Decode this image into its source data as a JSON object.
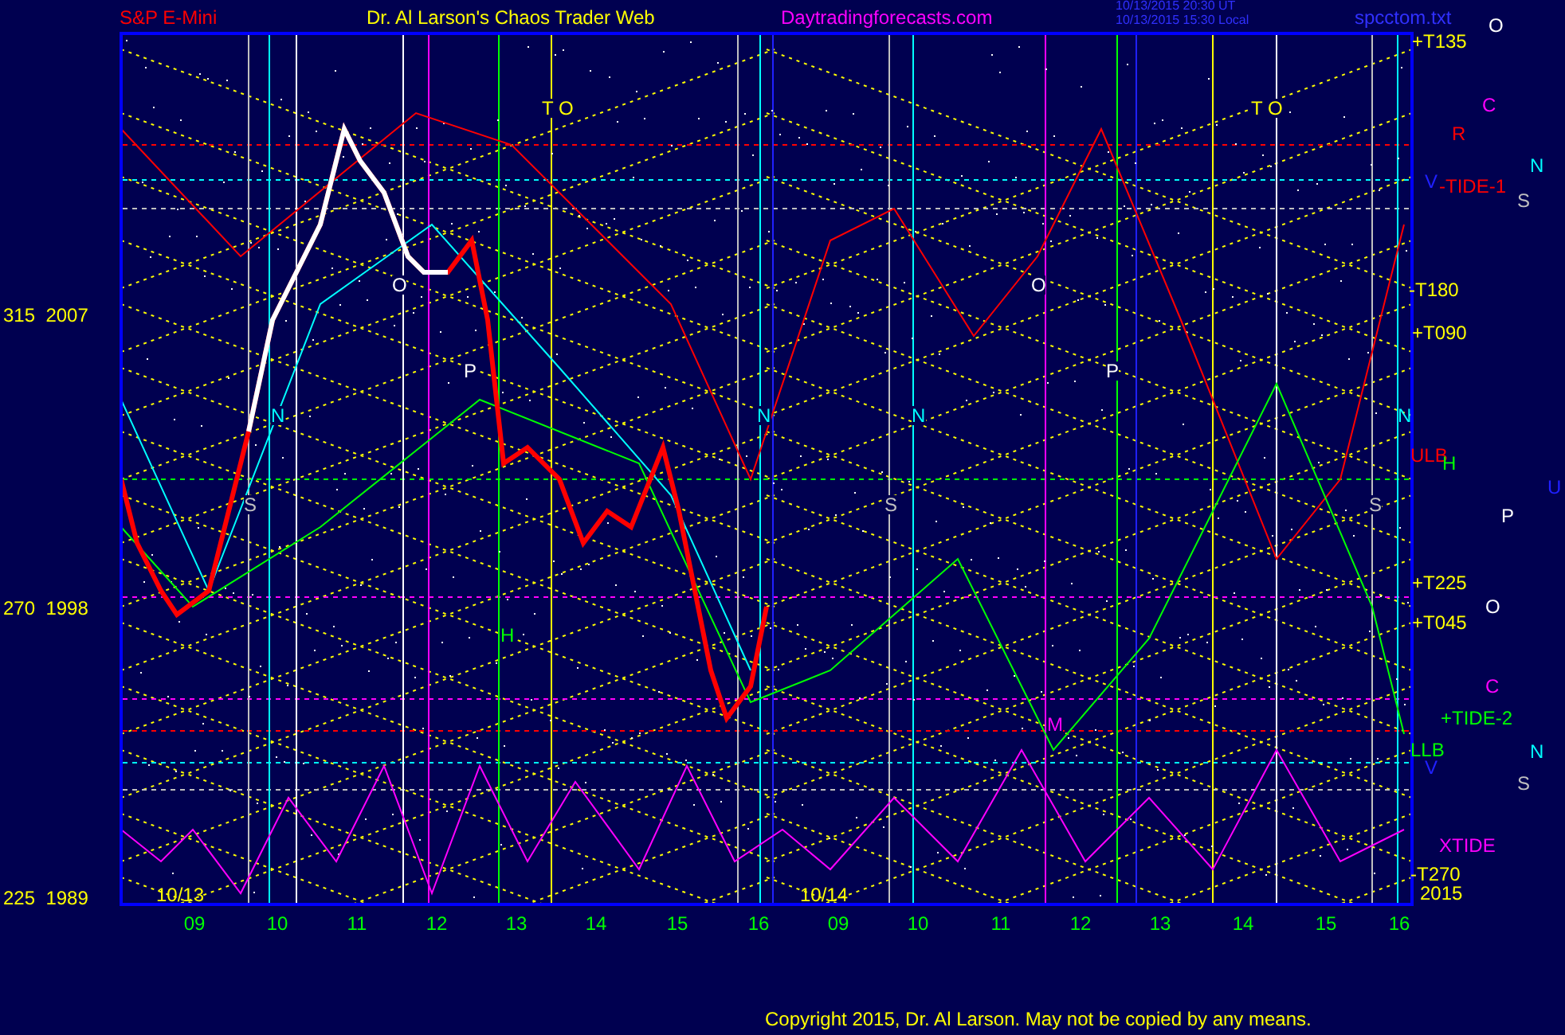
{
  "header": {
    "symbol": "S&P E-Mini",
    "title": "Dr. Al Larson's Chaos Trader Web",
    "site": "Daytradingforecasts.com",
    "time_ut": "10/13/2015 20:30 UT",
    "time_local": "10/13/2015 15:30 Local",
    "file": "spcctom.txt",
    "marker": "O"
  },
  "price_axis": [
    {
      "degree": "315",
      "price": "2007"
    },
    {
      "degree": "270",
      "price": "1998"
    },
    {
      "degree": "225",
      "price": "1989"
    }
  ],
  "days": [
    "10/13",
    "10/14"
  ],
  "hours": [
    "09",
    "10",
    "11",
    "12",
    "13",
    "14",
    "15",
    "16",
    "09",
    "10",
    "11",
    "12",
    "13",
    "14",
    "15",
    "16"
  ],
  "plot_labels": [
    {
      "text": "T O",
      "color": "#ffff00"
    },
    {
      "text": "T O",
      "color": "#ffff00"
    },
    {
      "text": "N",
      "color": "#00ffff"
    },
    {
      "text": "S",
      "color": "#c0c0c0"
    },
    {
      "text": "O",
      "color": "#ffffff"
    },
    {
      "text": "P",
      "color": "#ffffff"
    },
    {
      "text": "H",
      "color": "#00ff00"
    },
    {
      "text": "N",
      "color": "#00ffff"
    },
    {
      "text": "N",
      "color": "#00ffff"
    },
    {
      "text": "S",
      "color": "#c0c0c0"
    },
    {
      "text": "O",
      "color": "#ffffff"
    },
    {
      "text": "P",
      "color": "#ffffff"
    },
    {
      "text": "S",
      "color": "#c0c0c0"
    },
    {
      "text": "M",
      "color": "#ff00ff"
    }
  ],
  "side_labels": [
    {
      "text": "+T135",
      "color": "#ffff00"
    },
    {
      "text": "C",
      "color": "#ff00ff"
    },
    {
      "text": "R",
      "color": "#ff0000"
    },
    {
      "text": "N",
      "color": "#00ffff"
    },
    {
      "text": "V",
      "color": "#2020ff"
    },
    {
      "text": "-TIDE-1",
      "color": "#ff0000"
    },
    {
      "text": "S",
      "color": "#c0c0c0"
    },
    {
      "text": "-T180",
      "color": "#ffff00"
    },
    {
      "text": "+T090",
      "color": "#ffff00"
    },
    {
      "text": "N",
      "color": "#00ffff"
    },
    {
      "text": "ULB",
      "color": "#ff0000"
    },
    {
      "text": "H",
      "color": "#00ff00"
    },
    {
      "text": "U",
      "color": "#2020ff"
    },
    {
      "text": "P",
      "color": "#ffffff"
    },
    {
      "text": "+T225",
      "color": "#ffff00"
    },
    {
      "text": "O",
      "color": "#ffffff"
    },
    {
      "text": "+T045",
      "color": "#ffff00"
    },
    {
      "text": "C",
      "color": "#ff00ff"
    },
    {
      "text": "+TIDE-2",
      "color": "#00ff00"
    },
    {
      "text": "LLB",
      "color": "#00ff00"
    },
    {
      "text": "V",
      "color": "#2020ff"
    },
    {
      "text": "N",
      "color": "#00ffff"
    },
    {
      "text": "S",
      "color": "#c0c0c0"
    },
    {
      "text": "XTIDE",
      "color": "#ff00ff"
    },
    {
      "text": "-T270",
      "color": "#ffff00"
    },
    {
      "text": "2015",
      "color": "#ffff00"
    }
  ],
  "copyright": "Copyright 2015, Dr. Al Larson. May not be copied by any means."
}
